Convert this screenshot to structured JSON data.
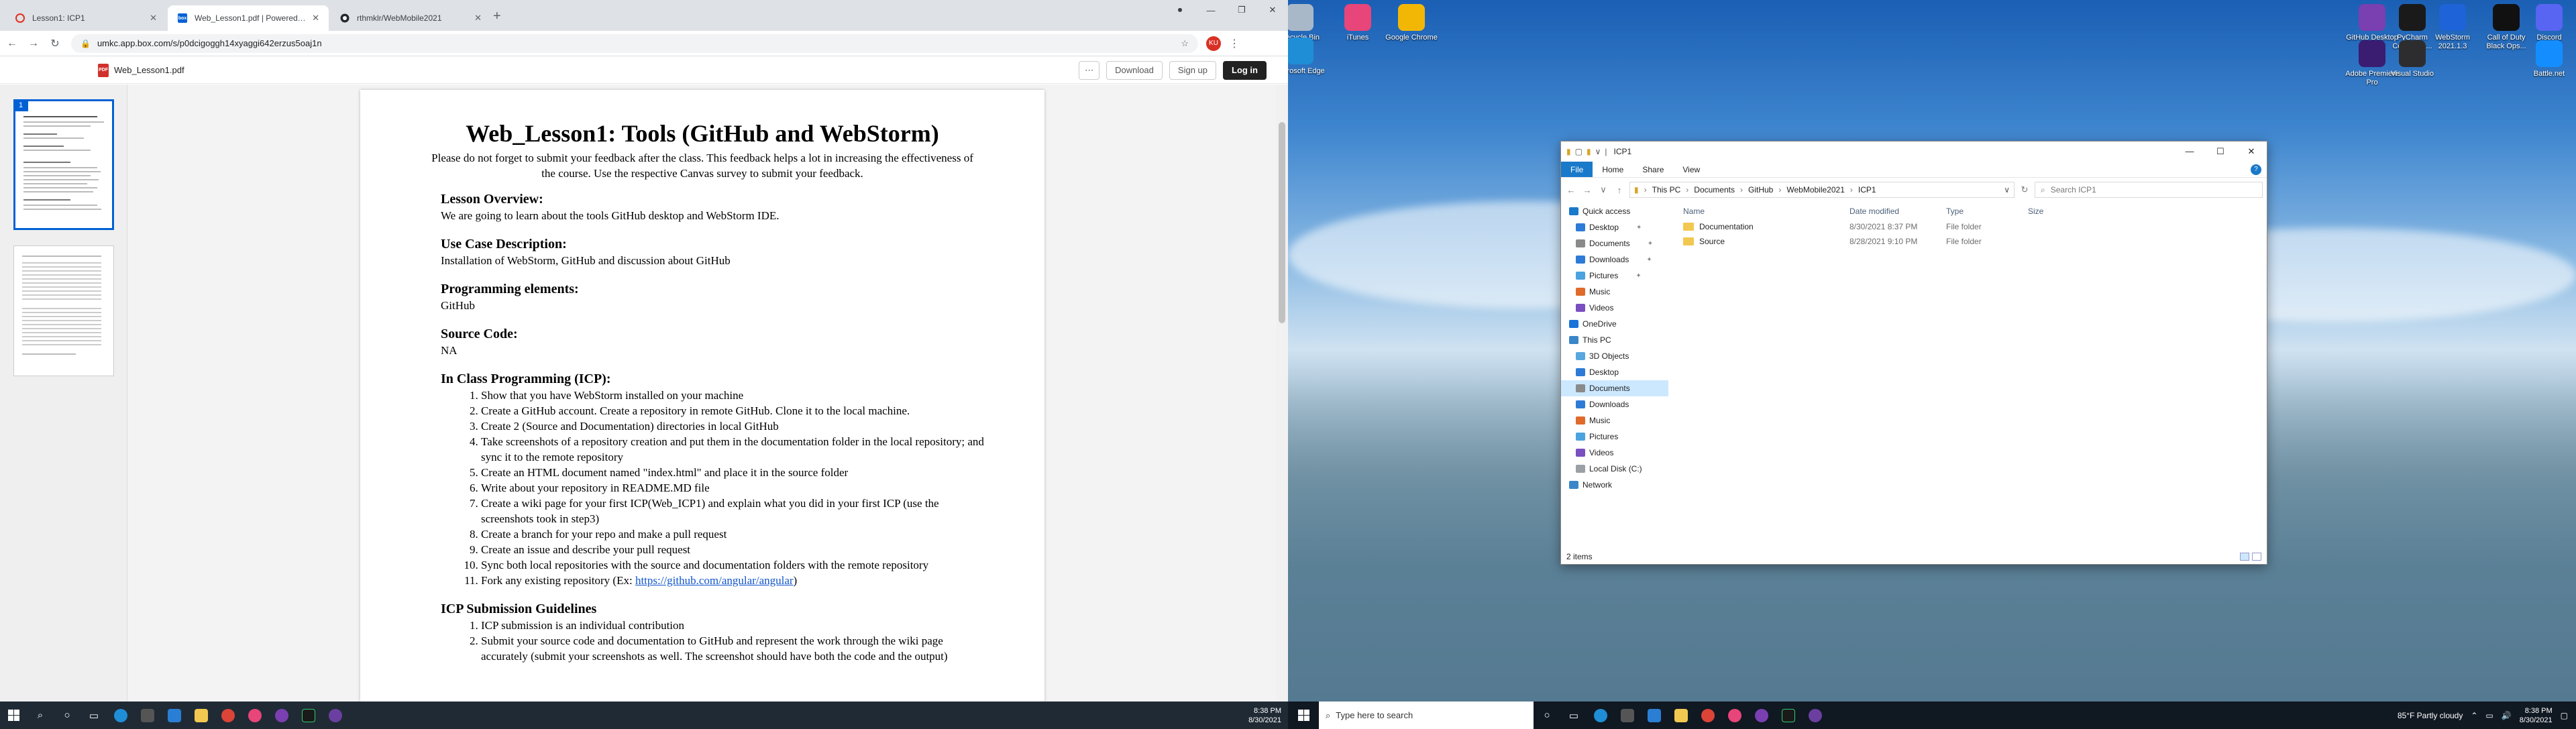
{
  "browser": {
    "tabs": [
      {
        "label": "Lesson1: ICP1",
        "active": false
      },
      {
        "label": "Web_Lesson1.pdf | Powered by Box",
        "active": true
      },
      {
        "label": "rthmklr/WebMobile2021",
        "active": false
      }
    ],
    "url": "umkc.app.box.com/s/p0dcigoggh14xyaggi642erzus5oaj1n",
    "profile_initials": "KU"
  },
  "box": {
    "filename": "Web_Lesson1.pdf",
    "download_label": "Download",
    "signup_label": "Sign up",
    "login_label": "Log in",
    "more_label": "⋯",
    "thumb_page_number": "1"
  },
  "document": {
    "title": "Web_Lesson1: Tools (GitHub and WebStorm)",
    "intro": "Please do not forget to submit your feedback after the class. This feedback helps a lot in increasing the effectiveness of the course. Use the respective Canvas survey to submit your feedback.",
    "sections": [
      {
        "heading": "Lesson Overview:",
        "text": "We are going to learn about the tools GitHub desktop and WebStorm IDE."
      },
      {
        "heading": "Use Case Description:",
        "text": "Installation of WebStorm, GitHub and discussion about GitHub"
      },
      {
        "heading": "Programming elements:",
        "text": "GitHub"
      },
      {
        "heading": "Source Code:",
        "text": "NA"
      }
    ],
    "icp_heading": "In Class Programming (ICP):",
    "icp_items": [
      "Show that you have WebStorm installed on your machine",
      "Create a GitHub account. Create a repository in remote GitHub. Clone it to the local machine.",
      "Create 2 (Source and Documentation) directories in local GitHub",
      "Take screenshots of a repository creation and put them in the documentation folder in the local repository; and sync it to the remote repository",
      "Create an HTML document named \"index.html\" and place it in the source folder",
      "Write about your repository in README.MD file",
      "Create a wiki page for your first ICP(Web_ICP1) and explain what you did in your first ICP (use the screenshots took in step3)",
      "Create a branch for your repo and make a pull request",
      "Create an issue and describe your pull request",
      "Sync both local repositories with the source and documentation folders with the remote repository"
    ],
    "icp_last_prefix": "Fork any existing repository (Ex: ",
    "icp_last_link": "https://github.com/angular/angular",
    "icp_last_suffix": ")",
    "guidelines_heading": "ICP Submission Guidelines",
    "guidelines": [
      "ICP submission is an individual contribution",
      "Submit your source code and documentation to GitHub and represent the work through the wiki page accurately (submit your screenshots as well. The screenshot should have both the code and the output)"
    ]
  },
  "left_taskbar": {
    "time": "8:38 PM",
    "date": "8/30/2021"
  },
  "desktop_icons": [
    {
      "label": "Recycle Bin",
      "icon": "recycle-bin-icon",
      "color": "#a9b8c8"
    },
    {
      "label": "iTunes",
      "icon": "itunes-icon",
      "color": "#e8457a"
    },
    {
      "label": "Google Chrome",
      "icon": "chrome-icon",
      "color": "#f2b705"
    },
    {
      "label": "Microsoft Edge",
      "icon": "edge-icon",
      "color": "#1f8ed6"
    },
    {
      "label": "GitHub Desktop",
      "icon": "github-desktop-icon",
      "color": "#7a3fb0"
    },
    {
      "label": "PyCharm Communit...",
      "icon": "pycharm-icon",
      "color": "#1a1a1a"
    },
    {
      "label": "WebStorm 2021.1.3",
      "icon": "webstorm-icon",
      "color": "#1e63d8"
    },
    {
      "label": "Call of Duty Black Ops...",
      "icon": "call-of-duty-icon",
      "color": "#111111"
    },
    {
      "label": "Discord",
      "icon": "discord-icon",
      "color": "#5865f2"
    },
    {
      "label": "Adobe Premiere Pro",
      "icon": "premiere-pro-icon",
      "color": "#3a1c71"
    },
    {
      "label": "Visual Studio",
      "icon": "visual-studio-icon",
      "color": "#2d2d30"
    },
    {
      "label": "Battle.net",
      "icon": "battlenet-icon",
      "color": "#148eff"
    }
  ],
  "explorer": {
    "title": "ICP1",
    "ribbon": [
      "File",
      "Home",
      "Share",
      "View"
    ],
    "breadcrumb": [
      "This PC",
      "Documents",
      "GitHub",
      "WebMobile2021",
      "ICP1"
    ],
    "search_placeholder": "Search ICP1",
    "nav": [
      {
        "label": "Quick access",
        "icon_color": "#1979ca",
        "level": 0,
        "pinned": false
      },
      {
        "label": "Desktop",
        "icon_color": "#2d7bd6",
        "level": 1,
        "pinned": true
      },
      {
        "label": "Documents",
        "icon_color": "#8a8a8a",
        "level": 1,
        "pinned": true
      },
      {
        "label": "Downloads",
        "icon_color": "#2d7bd6",
        "level": 1,
        "pinned": true
      },
      {
        "label": "Pictures",
        "icon_color": "#4aa3df",
        "level": 1,
        "pinned": true
      },
      {
        "label": "Music",
        "icon_color": "#e06a2a",
        "level": 1,
        "pinned": false
      },
      {
        "label": "Videos",
        "icon_color": "#7a4fc0",
        "level": 1,
        "pinned": false
      },
      {
        "label": "OneDrive",
        "icon_color": "#1a73d8",
        "level": 0,
        "pinned": false
      },
      {
        "label": "This PC",
        "icon_color": "#3a86c8",
        "level": 0,
        "pinned": false
      },
      {
        "label": "3D Objects",
        "icon_color": "#5aa7de",
        "level": 1,
        "pinned": false
      },
      {
        "label": "Desktop",
        "icon_color": "#2d7bd6",
        "level": 1,
        "pinned": false
      },
      {
        "label": "Documents",
        "icon_color": "#8a8a8a",
        "level": 1,
        "pinned": false,
        "selected": true
      },
      {
        "label": "Downloads",
        "icon_color": "#2d7bd6",
        "level": 1,
        "pinned": false
      },
      {
        "label": "Music",
        "icon_color": "#e06a2a",
        "level": 1,
        "pinned": false
      },
      {
        "label": "Pictures",
        "icon_color": "#4aa3df",
        "level": 1,
        "pinned": false
      },
      {
        "label": "Videos",
        "icon_color": "#7a4fc0",
        "level": 1,
        "pinned": false
      },
      {
        "label": "Local Disk (C:)",
        "icon_color": "#9aa0a6",
        "level": 1,
        "pinned": false
      },
      {
        "label": "Network",
        "icon_color": "#3a86c8",
        "level": 0,
        "pinned": false
      }
    ],
    "columns": [
      "Name",
      "Date modified",
      "Type",
      "Size"
    ],
    "rows": [
      {
        "name": "Documentation",
        "date": "8/30/2021 8:37 PM",
        "type": "File folder",
        "size": ""
      },
      {
        "name": "Source",
        "date": "8/28/2021 9:10 PM",
        "type": "File folder",
        "size": ""
      }
    ],
    "status": "2 items"
  },
  "right_taskbar": {
    "search_placeholder": "Type here to search",
    "weather": "85°F  Partly cloudy",
    "time": "8:38 PM",
    "date": "8/30/2021"
  }
}
